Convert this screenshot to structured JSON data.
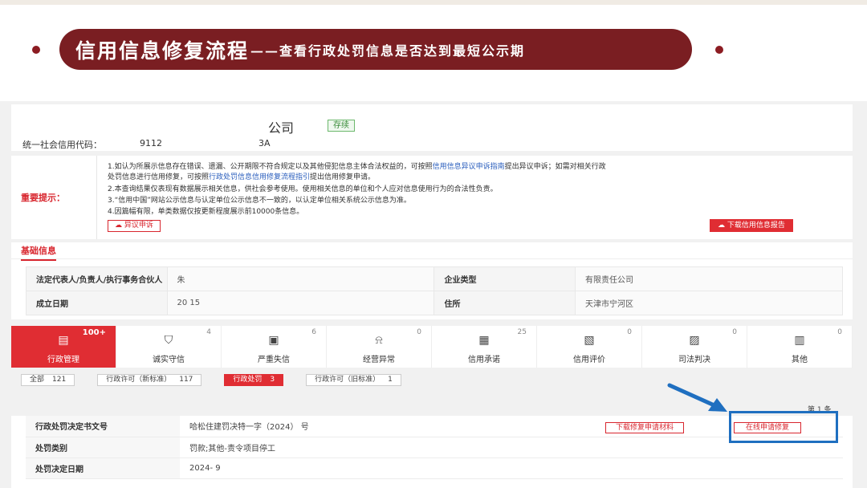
{
  "banner": {
    "title_main": "信用信息修复流程",
    "title_sub": "——查看行政处罚信息是否达到最短公示期"
  },
  "company": {
    "name": "公司",
    "status": "存续",
    "credit_label": "统一社会信用代码：",
    "credit_code_head": "9112",
    "credit_code_tail": "3A"
  },
  "notice": {
    "title": "重要提示：",
    "line1_a": "1.如认为所展示信息存在错误、遗漏、公开期限不符合规定以及其他侵犯信息主体合法权益的，可按照",
    "line1_link": "信用信息异议申诉指南",
    "line1_b": "提出异议申诉；如需对相关行政",
    "line2_a": "处罚信息进行信用修复，可按照",
    "line2_link": "行政处罚信息信用修复流程指引",
    "line2_b": "提出信用修复申请。",
    "line3": "2.本查询结果仅表现有数据展示相关信息，供社会参考使用。使用相关信息的单位和个人应对信息使用行为的合法性负责。",
    "line4": "3.“信用中国”网站公示信息与认定单位公示信息不一致的，以认定单位相关系统公示信息为准。",
    "line5": "4.因篇幅有限，单类数据仅按更新程度展示前10000条信息。",
    "objection_button": "异议申诉",
    "report_button": "下载信用信息报告",
    "colors": {
      "accent": "#e02d33",
      "link": "#2a5ebd"
    }
  },
  "basic_info": {
    "section_title": "基础信息",
    "rows": [
      {
        "label1": "法定代表人/负责人/执行事务合伙人",
        "value1": "朱",
        "label2": "企业类型",
        "value2": "有限责任公司"
      },
      {
        "label1": "成立日期",
        "value1": "20        15",
        "label2": "住所",
        "value2": "天津市宁河区"
      }
    ]
  },
  "tabs": [
    {
      "label": "行政管理",
      "count": "100+",
      "icon": "document-icon",
      "active": true
    },
    {
      "label": "诚实守信",
      "count": "4",
      "icon": "shield-check-icon",
      "active": false
    },
    {
      "label": "严重失信",
      "count": "6",
      "icon": "warning-card-icon",
      "active": false
    },
    {
      "label": "经营异常",
      "count": "0",
      "icon": "alarm-icon",
      "active": false
    },
    {
      "label": "信用承诺",
      "count": "25",
      "icon": "commitment-icon",
      "active": false
    },
    {
      "label": "信用评价",
      "count": "0",
      "icon": "evaluation-icon",
      "active": false
    },
    {
      "label": "司法判决",
      "count": "0",
      "icon": "judgment-icon",
      "active": false
    },
    {
      "label": "其他",
      "count": "0",
      "icon": "other-icon",
      "active": false
    }
  ],
  "filters": [
    {
      "label": "全部",
      "count": "121",
      "active": false
    },
    {
      "label": "行政许可（新标准）",
      "count": "117",
      "active": false
    },
    {
      "label": "行政处罚",
      "count": "3",
      "active": true
    },
    {
      "label": "行政许可（旧标准）",
      "count": "1",
      "active": false
    }
  ],
  "pagination": {
    "label": "第 1 条"
  },
  "case": {
    "rows": [
      {
        "label": "行政处罚决定书文号",
        "value": "哈松住建罚决特一字（2024）                号"
      },
      {
        "label": "处罚类别",
        "value": "罚款;其他-责令项目停工"
      },
      {
        "label": "处罚决定日期",
        "value": "2024-        9"
      }
    ],
    "download_button": "下载修复申请材料",
    "online_button": "在线申请修复",
    "highlight_color": "#1f6fc0"
  }
}
